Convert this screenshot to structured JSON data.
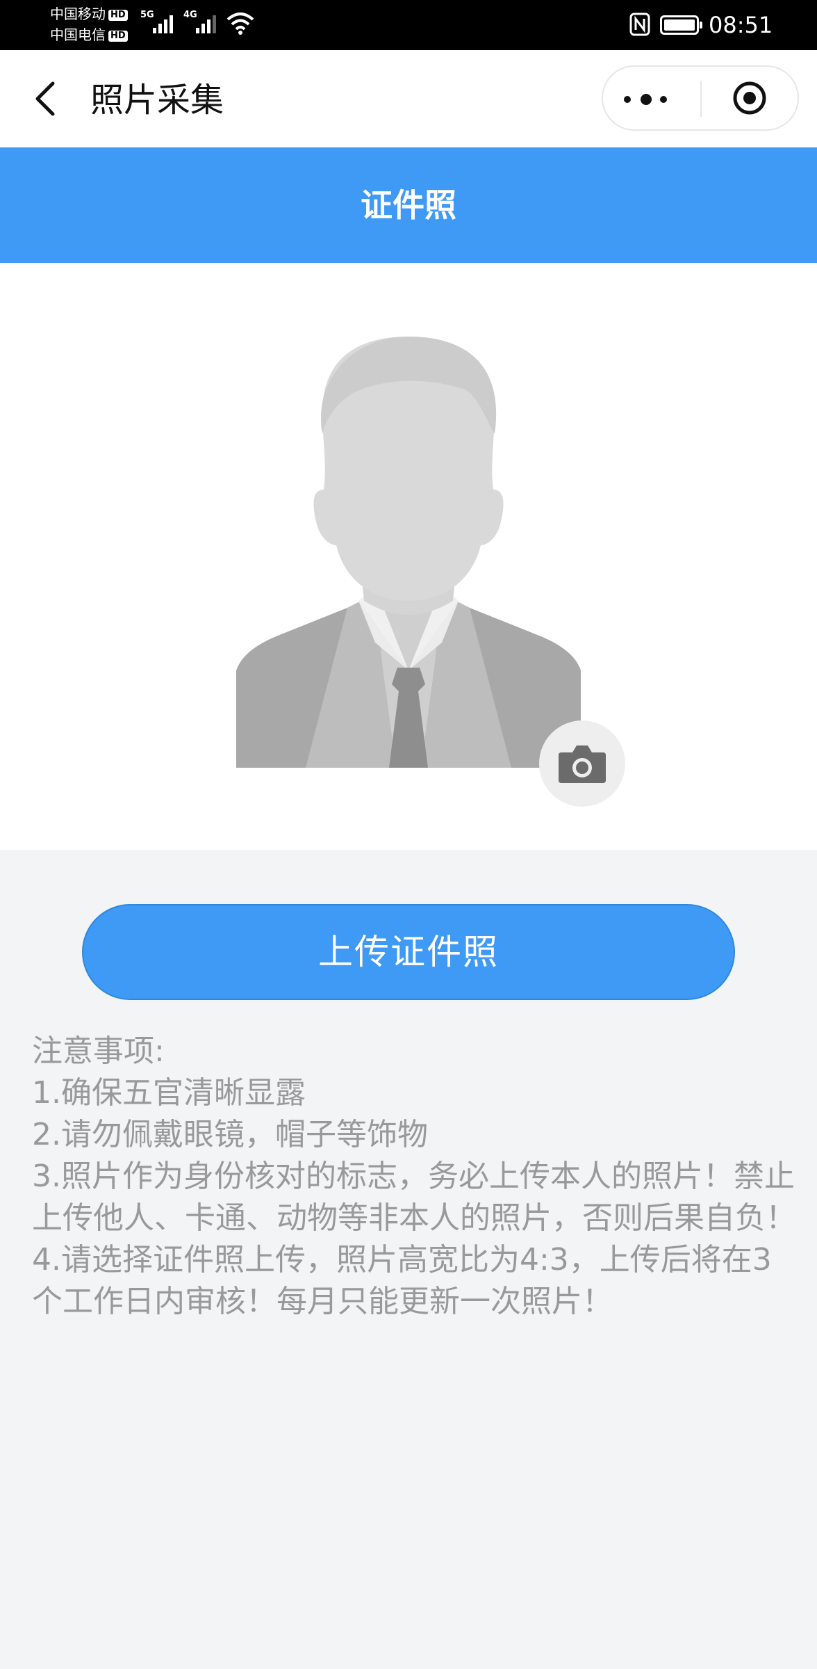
{
  "status_bar": {
    "carrier1": "中国移动",
    "carrier2": "中国电信",
    "hd_badge": "HD",
    "net1": "5G",
    "net2": "4G",
    "time": "08:51"
  },
  "nav": {
    "title": "照片采集"
  },
  "header": {
    "title": "证件照"
  },
  "upload": {
    "label": "上传证件照"
  },
  "notes": {
    "heading": "注意事项:",
    "items": [
      "1.确保五官清晰显露",
      "2.请勿佩戴眼镜，帽子等饰物",
      "3.照片作为身份核对的标志，务必上传本人的照片！禁止上传他人、卡通、动物等非本人的照片，否则后果自负！",
      "4.请选择证件照上传，照片高宽比为4:3，上传后将在3个工作日内审核！每月只能更新一次照片！"
    ]
  },
  "colors": {
    "accent": "#3e9af4",
    "page_bg": "#f3f4f6",
    "note_text": "#999999"
  },
  "icons": [
    "back-arrow-icon",
    "more-dots-icon",
    "target-icon",
    "camera-icon",
    "wifi-icon",
    "nfc-icon",
    "battery-icon",
    "signal-icon"
  ]
}
